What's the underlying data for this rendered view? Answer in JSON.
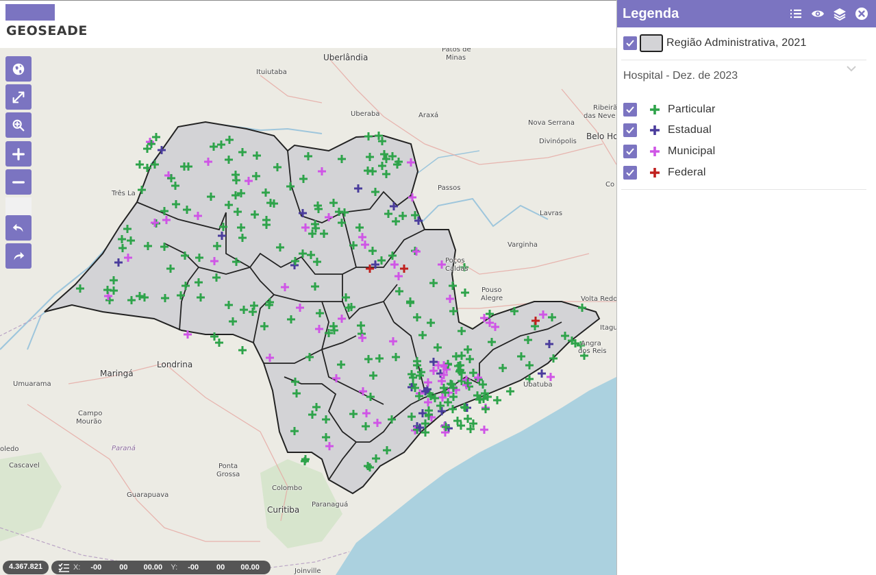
{
  "header": {
    "logo_text": "GEOSEADE"
  },
  "legend": {
    "title": "Legenda",
    "icons": [
      "list-icon",
      "eye-icon",
      "layers-icon",
      "close-icon"
    ],
    "region_layer": {
      "label": "Região Administrativa, 2021",
      "checked": true,
      "fill": "#d3d3d6",
      "stroke": "#222222"
    },
    "hospital_group": {
      "title": "Hospital - Dez. de 2023",
      "items": [
        {
          "label": "Particular",
          "color": "#2ea34a",
          "checked": true
        },
        {
          "label": "Estadual",
          "color": "#4a3c9c",
          "checked": true
        },
        {
          "label": "Municipal",
          "color": "#cf55e6",
          "checked": true
        },
        {
          "label": "Federal",
          "color": "#c0201e",
          "checked": true
        }
      ]
    }
  },
  "map": {
    "cities": [
      {
        "name": "Uberlândia",
        "size": "big"
      },
      {
        "name": "Patos de",
        "size": "small"
      },
      {
        "name": "Minas",
        "size": "small"
      },
      {
        "name": "Ituiutaba",
        "size": "small"
      },
      {
        "name": "Uberaba",
        "size": "small"
      },
      {
        "name": "Araxá",
        "size": "small"
      },
      {
        "name": "Ribeirão",
        "size": "small"
      },
      {
        "name": "das Neve",
        "size": "small"
      },
      {
        "name": "Nova Serrana",
        "size": "small"
      },
      {
        "name": "Divinópolis",
        "size": "small"
      },
      {
        "name": "Belo Ho",
        "size": "big"
      },
      {
        "name": "Três La",
        "size": "small"
      },
      {
        "name": "Passos",
        "size": "small"
      },
      {
        "name": "Lavras",
        "size": "small"
      },
      {
        "name": "Co",
        "size": "small"
      },
      {
        "name": "Varginha",
        "size": "small"
      },
      {
        "name": "Poços",
        "size": "small"
      },
      {
        "name": "Caldas",
        "size": "small"
      },
      {
        "name": "Pouso",
        "size": "small"
      },
      {
        "name": "Alegre",
        "size": "small"
      },
      {
        "name": "Volta Redo",
        "size": "small"
      },
      {
        "name": "Itagu",
        "size": "small"
      },
      {
        "name": "Angra",
        "size": "small"
      },
      {
        "name": "dos Reis",
        "size": "small"
      },
      {
        "name": "Maringá",
        "size": "big"
      },
      {
        "name": "Londrina",
        "size": "big"
      },
      {
        "name": "Umuarama",
        "size": "small"
      },
      {
        "name": "Campo",
        "size": "small"
      },
      {
        "name": "Mourão",
        "size": "small"
      },
      {
        "name": "Paraná",
        "size": "state"
      },
      {
        "name": "oledo",
        "size": "small"
      },
      {
        "name": "Cascavel",
        "size": "small"
      },
      {
        "name": "Ponta",
        "size": "small"
      },
      {
        "name": "Grossa",
        "size": "small"
      },
      {
        "name": "Guarapuava",
        "size": "small"
      },
      {
        "name": "Colombo",
        "size": "small"
      },
      {
        "name": "Curitiba",
        "size": "big"
      },
      {
        "name": "Paranaguá",
        "size": "small"
      },
      {
        "name": "Ubatuba",
        "size": "small"
      },
      {
        "name": "Joinville",
        "size": "small"
      }
    ],
    "tools": [
      {
        "name": "globe-icon-button"
      },
      {
        "name": "fullscreen-icon-button"
      },
      {
        "name": "zoom-area-icon-button"
      },
      {
        "name": "zoom-in-button"
      },
      {
        "name": "zoom-out-button"
      },
      {
        "name": "undo-button"
      },
      {
        "name": "redo-button"
      }
    ]
  },
  "status": {
    "scale": "4.367.821",
    "x_label": "X:",
    "x_deg": "-00",
    "x_min": "00",
    "x_sec": "00.00",
    "y_label": "Y:",
    "y_deg": "-00",
    "y_min": "00",
    "y_sec": "00.00"
  }
}
